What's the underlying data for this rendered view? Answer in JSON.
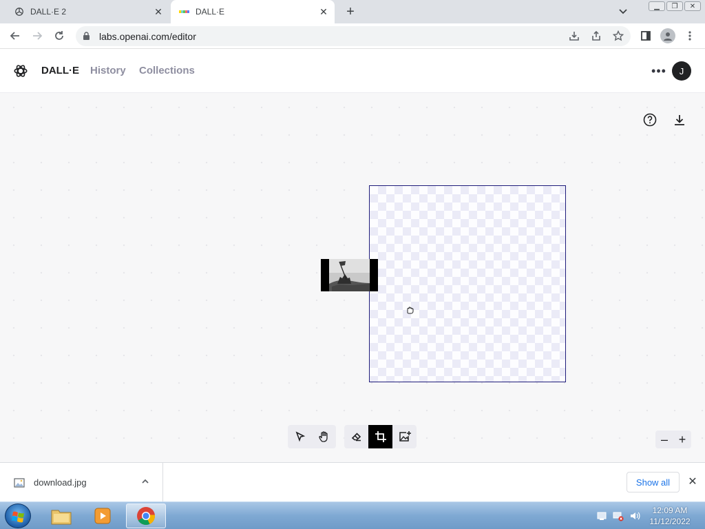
{
  "browser": {
    "tabs": [
      {
        "title": "DALL·E 2",
        "active": false
      },
      {
        "title": "DALL·E",
        "active": true
      }
    ],
    "url": "labs.openai.com/editor"
  },
  "app": {
    "brand": "DALL·E",
    "nav": [
      "History",
      "Collections"
    ],
    "avatar_initial": "J"
  },
  "editor": {
    "tools": [
      "select",
      "pan",
      "eraser",
      "add-generation-frame",
      "upload-image"
    ],
    "active_tool": "add-generation-frame",
    "zoom_out_label": "–",
    "zoom_in_label": "+"
  },
  "downloads": {
    "file_name": "download.jpg",
    "show_all_label": "Show all"
  },
  "taskbar": {
    "time": "12:09 AM",
    "date": "11/12/2022"
  },
  "colors": {
    "frame_border": "#1e1b7a",
    "active_tool_bg": "#000000",
    "link_blue": "#1a73e8"
  }
}
